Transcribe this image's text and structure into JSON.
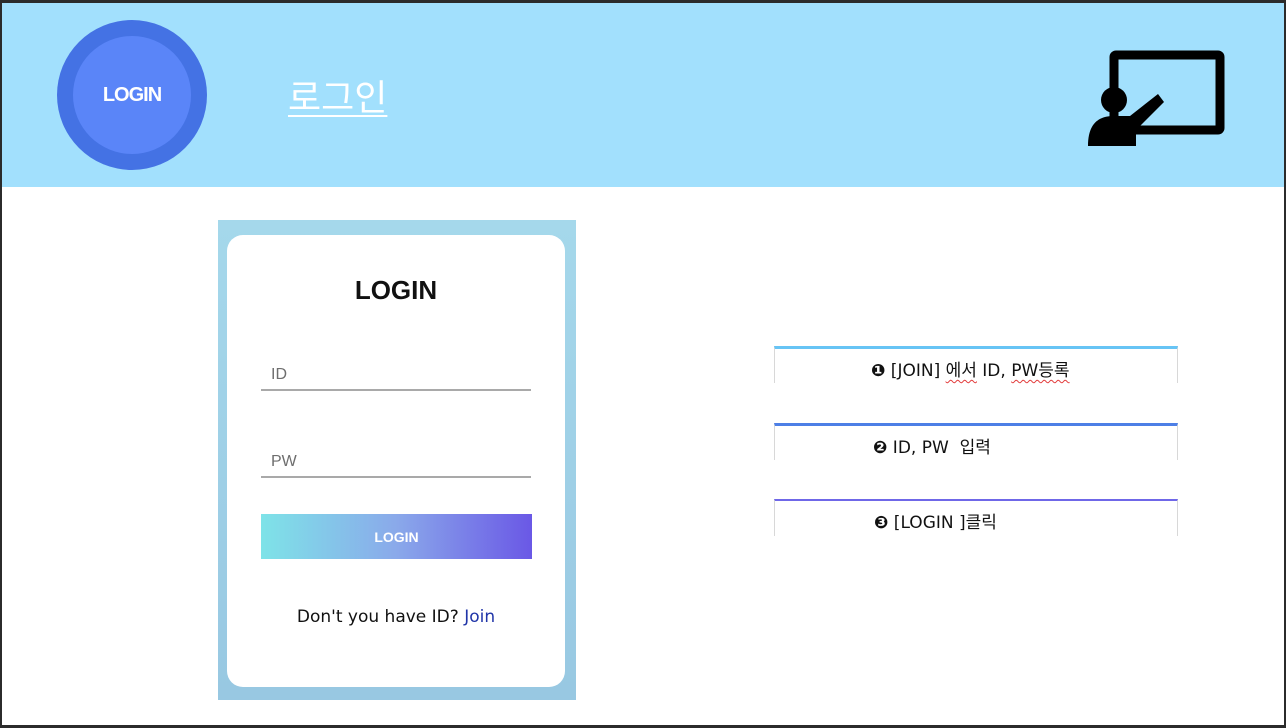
{
  "header": {
    "badge_label": "LOGIN",
    "title": "로그인",
    "teacher_icon": "presentation-teacher-icon",
    "background_color": "#a2e0fd"
  },
  "login_card": {
    "title": "LOGIN",
    "id_placeholder": "ID",
    "pw_placeholder": "PW",
    "button_label": "LOGIN",
    "join_prompt": "Don't you have ID?",
    "join_link": "Join"
  },
  "steps": [
    {
      "marker": "❶",
      "text_before": " [JOIN] ",
      "text_underlined": "에서",
      "text_middle": " ID, ",
      "text_underlined_2": "PW등록",
      "color": "#67c4f5"
    },
    {
      "marker": "❷",
      "text": " ID, PW  입력",
      "color": "#4d7fe6"
    },
    {
      "marker": "❸",
      "text": " [LOGIN ]클릭",
      "color": "#6f67e8"
    }
  ]
}
